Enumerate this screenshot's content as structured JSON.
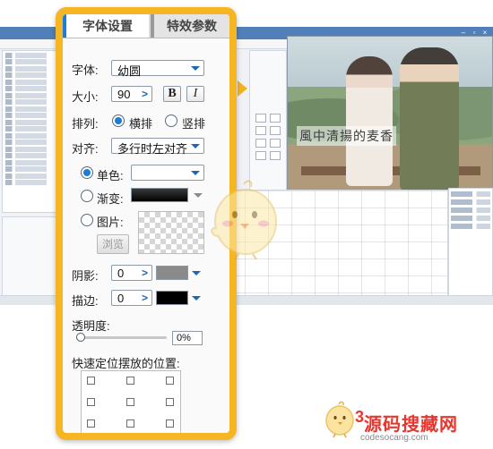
{
  "tabs": {
    "font_settings": "字体设置",
    "effect_params": "特效参数"
  },
  "font": {
    "label": "字体:",
    "value": "幼圆"
  },
  "size": {
    "label": "大小:",
    "value": "90",
    "bold_label": "B",
    "italic_label": "I"
  },
  "arrange": {
    "label": "排列:",
    "horizontal": "横排",
    "vertical": "竖排",
    "selected": "horizontal"
  },
  "align": {
    "label": "对齐:",
    "value": "多行时左对齐"
  },
  "fill": {
    "solid_label": "单色:",
    "gradient_label": "渐变:",
    "image_label": "图片:",
    "browse_label": "浏览",
    "selected": "solid",
    "gradient_color": "#000000"
  },
  "shadow": {
    "label": "阴影:",
    "value": "0",
    "color": "#8a8a8a"
  },
  "stroke": {
    "label": "描边:",
    "value": "0",
    "color": "#000000"
  },
  "opacity": {
    "label": "透明度:",
    "value_text": "0%",
    "value": 0
  },
  "quick_position": {
    "label": "快速定位摆放的位置:"
  },
  "preview": {
    "subtitle_text": "風中清揚的麦香"
  },
  "watermark": {
    "number": "3",
    "text": "源码搜藏网",
    "url": "codesocang.com"
  },
  "colors": {
    "accent": "#1c7cd6",
    "panel_frame": "#f6b624",
    "watermark": "#e8362e"
  }
}
